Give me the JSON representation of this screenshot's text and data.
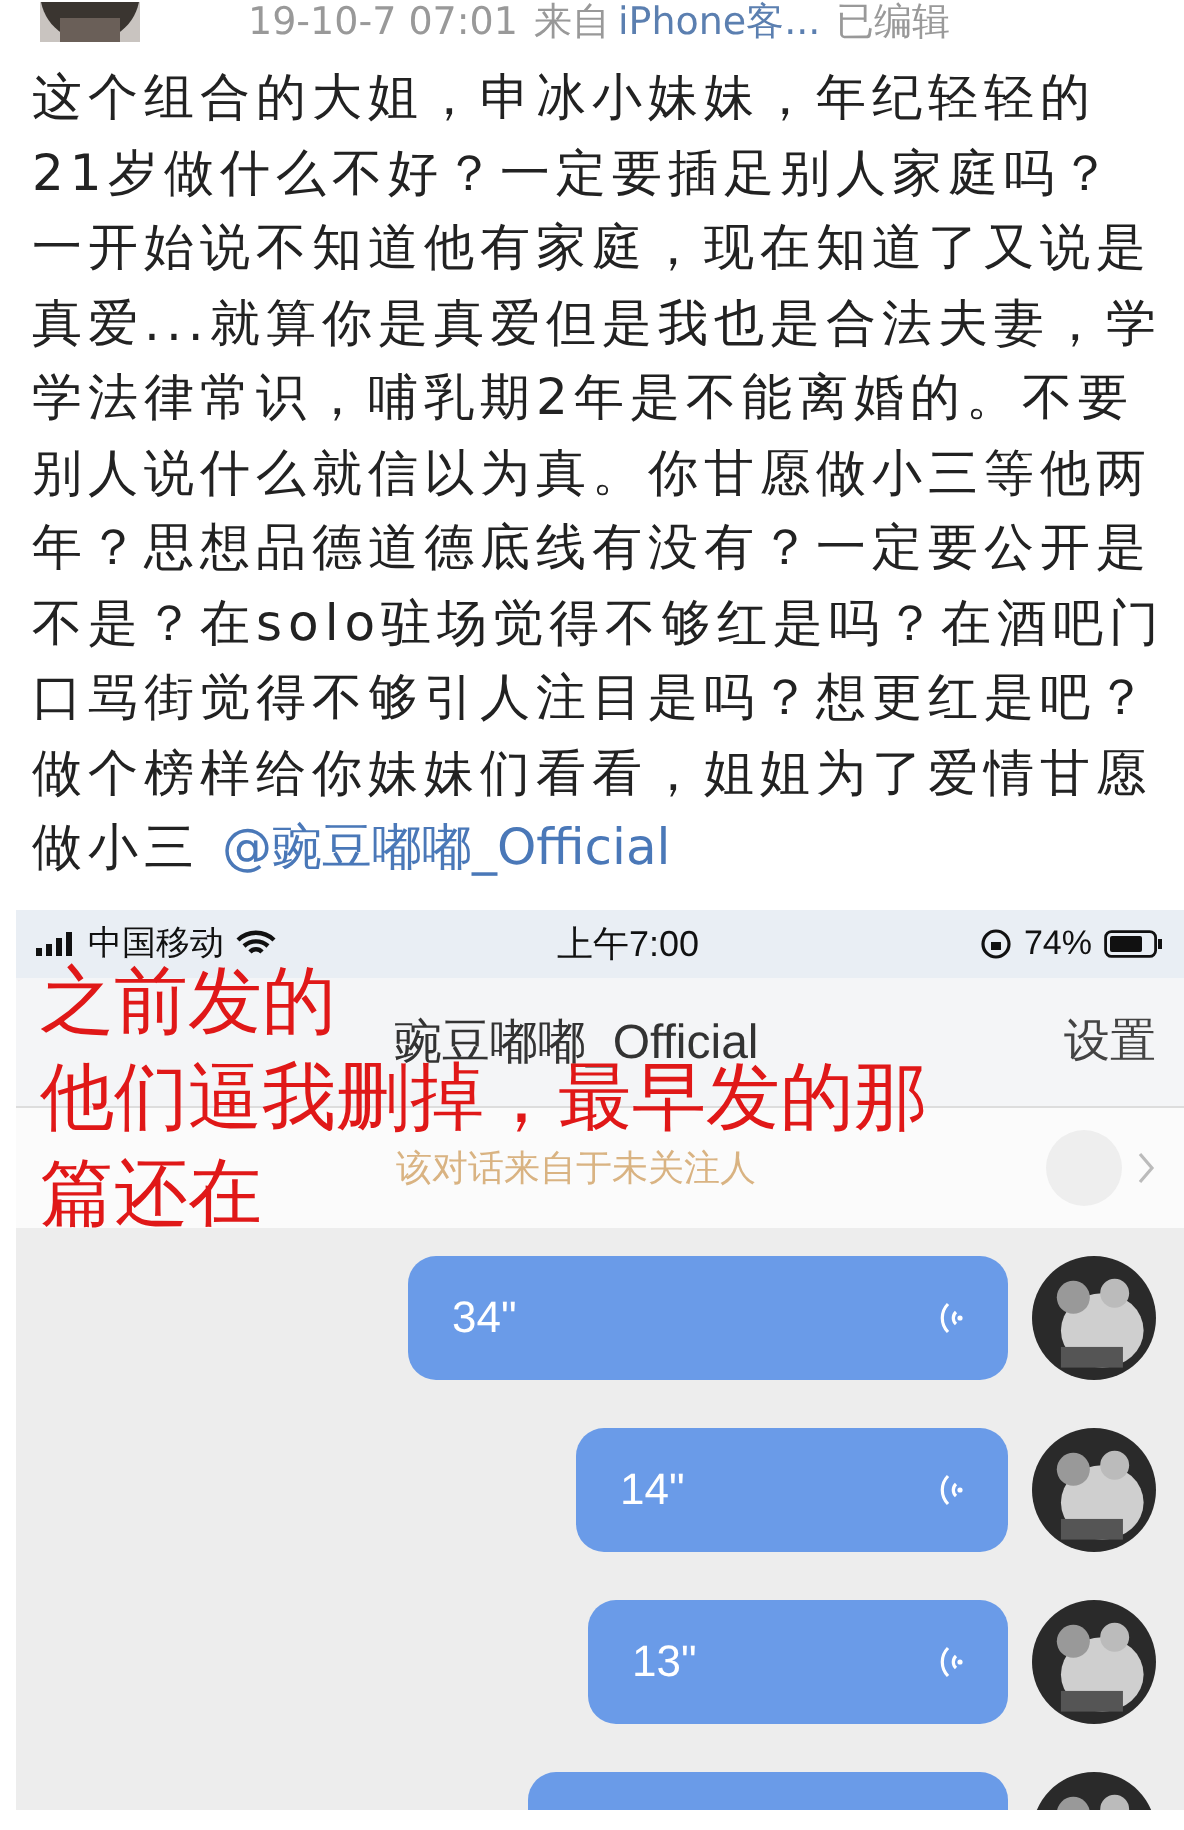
{
  "post": {
    "time": "19-10-7 07:01",
    "source_prefix": "来自",
    "source": "iPhone客...",
    "edited": "已编辑",
    "text": "这个组合的大姐，申冰小妹妹，年纪轻轻的21岁做什么不好？一定要插足别人家庭吗？一开始说不知道他有家庭，现在知道了又说是真爱...就算你是真爱但是我也是合法夫妻，学学法律常识，哺乳期2年是不能离婚的。不要别人说什么就信以为真。你甘愿做小三等他两年？思想品德道德底线有没有？一定要公开是不是？在solo驻场觉得不够红是吗？在酒吧门口骂街觉得不够引人注目是吗？想更红是吧？做个榜样给你妹妹们看看，姐姐为了爱情甘愿做小三 ",
    "mention": "@豌豆嘟嘟_Official"
  },
  "chat": {
    "status_bar": {
      "carrier": "中国移动",
      "time": "上午7:00",
      "battery": "74%"
    },
    "title": "豌豆嘟嘟_Official",
    "settings": "设置",
    "notice": "该对话来自于未关注人",
    "messages": [
      {
        "kind": "voice",
        "duration": "34\""
      },
      {
        "kind": "voice",
        "duration": "14\""
      },
      {
        "kind": "voice",
        "duration": "13\""
      },
      {
        "kind": "cut"
      }
    ]
  },
  "annotation": [
    "之前发的",
    "他们逼我删掉，最早发的那",
    "篇还在"
  ]
}
